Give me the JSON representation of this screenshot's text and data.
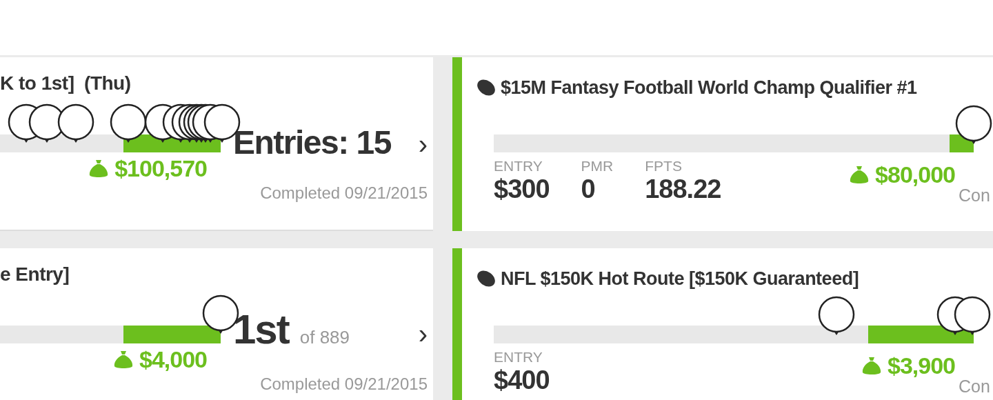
{
  "left_column": {
    "cards": [
      {
        "title": "K to 1st]  (Thu)",
        "level": 0.44,
        "prize": "$100,570",
        "result": {
          "kind": "entries",
          "text": "Entries: 15"
        },
        "chevron": "›",
        "status": "Completed 09/21/2015"
      },
      {
        "title": "e Entry]",
        "level": 0.44,
        "prize": "$4,000",
        "result": {
          "kind": "rank",
          "text": "1st",
          "of": "of 889"
        },
        "chevron": "›",
        "status": "Completed 09/21/2015"
      }
    ]
  },
  "right_column": {
    "cards": [
      {
        "title": "$15M Fantasy Football World Champ Qualifier #1",
        "level": 0.05,
        "stats": [
          {
            "label": "ENTRY",
            "value": "$300"
          },
          {
            "label": "PMR",
            "value": "0"
          },
          {
            "label": "FPTS",
            "value": "188.22"
          }
        ],
        "prize": "$80,000",
        "status": "Con"
      },
      {
        "title": "NFL $150K Hot Route [$150K Guaranteed]",
        "level": 0.22,
        "stats": [
          {
            "label": "ENTRY",
            "value": "$400"
          }
        ],
        "prize": "$3,900",
        "status": "Con"
      }
    ]
  }
}
